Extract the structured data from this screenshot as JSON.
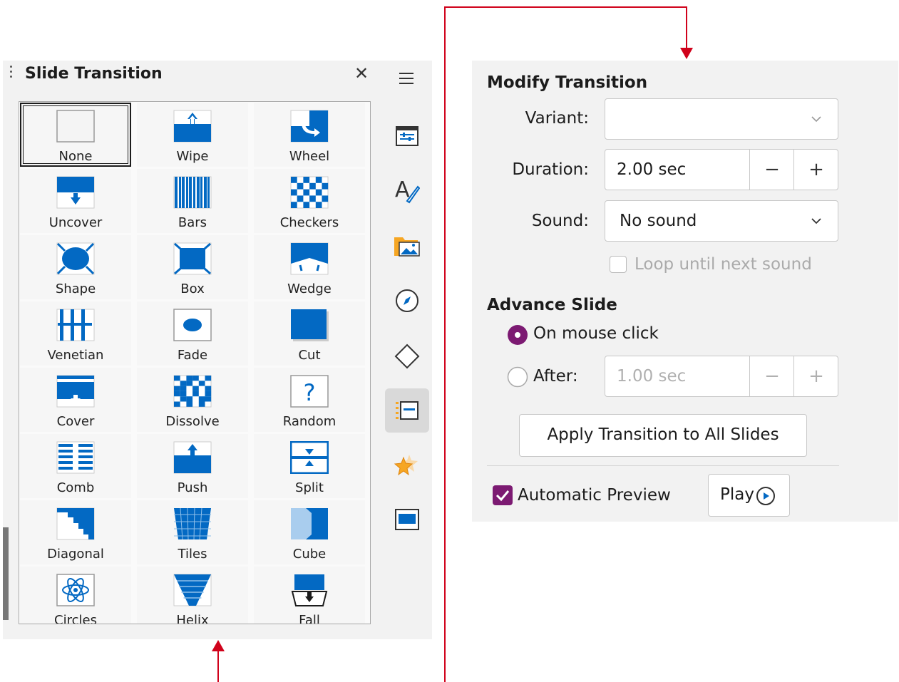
{
  "panel": {
    "title": "Slide Transition",
    "close_label": "✕"
  },
  "transitions": [
    {
      "label": "None",
      "icon": "none-icon"
    },
    {
      "label": "Wipe",
      "icon": "wipe-icon"
    },
    {
      "label": "Wheel",
      "icon": "wheel-icon"
    },
    {
      "label": "Uncover",
      "icon": "uncover-icon"
    },
    {
      "label": "Bars",
      "icon": "bars-icon"
    },
    {
      "label": "Checkers",
      "icon": "checkers-icon"
    },
    {
      "label": "Shape",
      "icon": "shape-icon"
    },
    {
      "label": "Box",
      "icon": "box-icon"
    },
    {
      "label": "Wedge",
      "icon": "wedge-icon"
    },
    {
      "label": "Venetian",
      "icon": "venetian-icon"
    },
    {
      "label": "Fade",
      "icon": "fade-icon"
    },
    {
      "label": "Cut",
      "icon": "cut-icon"
    },
    {
      "label": "Cover",
      "icon": "cover-icon"
    },
    {
      "label": "Dissolve",
      "icon": "dissolve-icon"
    },
    {
      "label": "Random",
      "icon": "random-icon"
    },
    {
      "label": "Comb",
      "icon": "comb-icon"
    },
    {
      "label": "Push",
      "icon": "push-icon"
    },
    {
      "label": "Split",
      "icon": "split-icon"
    },
    {
      "label": "Diagonal",
      "icon": "diagonal-icon"
    },
    {
      "label": "Tiles",
      "icon": "tiles-icon"
    },
    {
      "label": "Cube",
      "icon": "cube-icon"
    },
    {
      "label": "Circles",
      "icon": "circles-icon"
    },
    {
      "label": "Helix",
      "icon": "helix-icon"
    },
    {
      "label": "Fall",
      "icon": "fall-icon"
    }
  ],
  "selected_transition": "None",
  "sidebar_icons": [
    "menu-icon",
    "properties-icon",
    "styles-icon",
    "gallery-icon",
    "navigator-icon",
    "shapes-icon",
    "slide-transition-icon",
    "animation-icon",
    "master-slides-icon"
  ],
  "modify": {
    "title": "Modify Transition",
    "variant_label": "Variant:",
    "variant_value": "",
    "duration_label": "Duration:",
    "duration_value": "2.00 sec",
    "minus": "−",
    "plus": "+",
    "sound_label": "Sound:",
    "sound_value": "No sound",
    "loop_label": "Loop until next sound",
    "loop_checked": false
  },
  "advance": {
    "title": "Advance Slide",
    "on_click_label": "On mouse click",
    "after_label": "After:",
    "after_value": "1.00 sec",
    "selected": "On mouse click"
  },
  "apply_all_label": "Apply Transition to All Slides",
  "preview": {
    "auto_label": "Automatic Preview",
    "auto_checked": true,
    "play_label": "Play"
  },
  "colors": {
    "accent_blue": "#0369c3",
    "accent_purple": "#7c1a72",
    "annotation_red": "#d0021b"
  }
}
